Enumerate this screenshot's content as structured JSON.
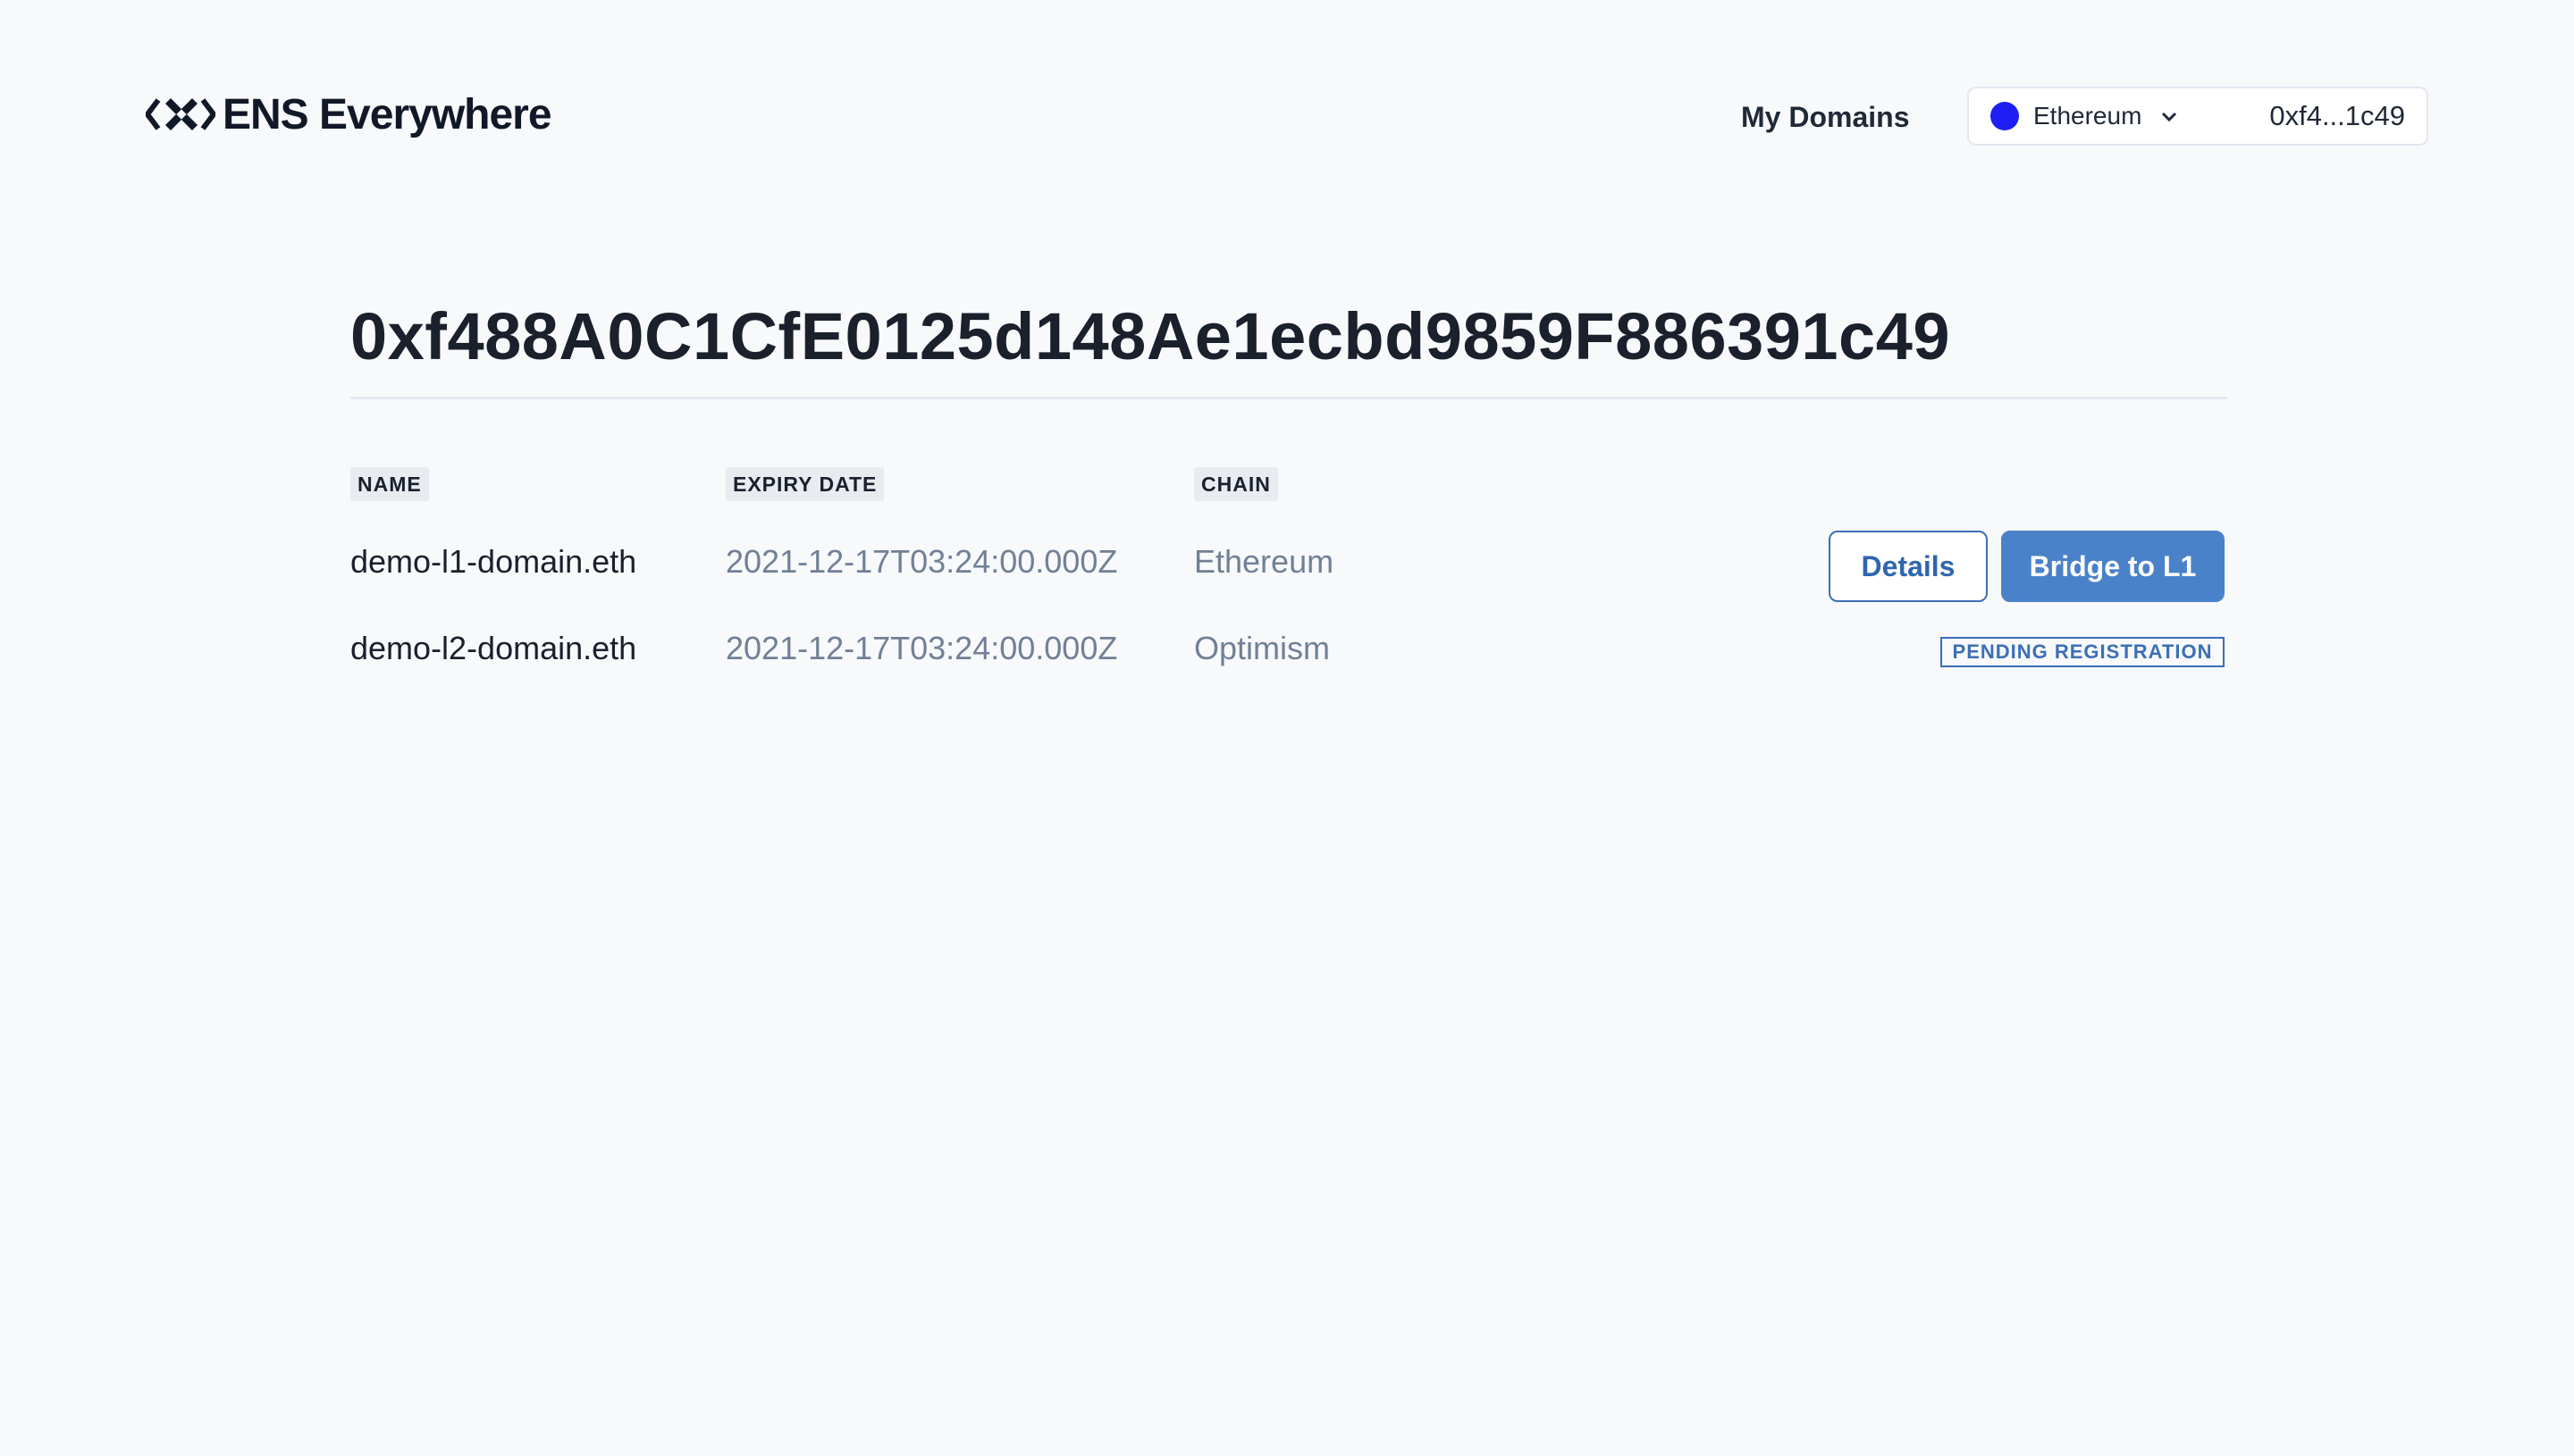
{
  "header": {
    "app_name": "ENS Everywhere",
    "nav_link": "My Domains",
    "network": {
      "label": "Ethereum",
      "dot_color": "#1e1ef5"
    },
    "wallet_address": "0xf4...1c49"
  },
  "main": {
    "address": "0xf488A0C1CfE0125d148Ae1ecbd9859F886391c49",
    "columns": [
      "NAME",
      "EXPIRY DATE",
      "CHAIN"
    ],
    "rows": [
      {
        "name": "demo-l1-domain.eth",
        "expiry": "2021-12-17T03:24:00.000Z",
        "chain": "Ethereum",
        "actions": {
          "details": "Details",
          "bridge": "Bridge to L1"
        }
      },
      {
        "name": "demo-l2-domain.eth",
        "expiry": "2021-12-17T03:24:00.000Z",
        "chain": "Optimism",
        "status": "PENDING REGISTRATION"
      }
    ]
  },
  "colors": {
    "background": "#f7f9fb",
    "accent": "#4a82c9",
    "text_dark": "#1a202c",
    "text_muted": "#718096"
  }
}
